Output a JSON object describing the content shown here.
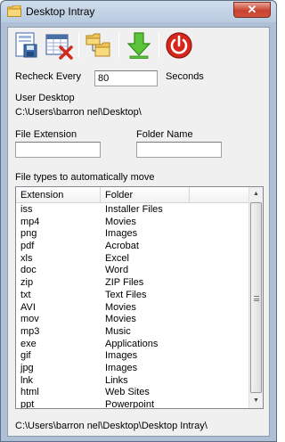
{
  "window": {
    "title": "Desktop Intray",
    "close_glyph": "✕"
  },
  "toolbar": {
    "buttons": [
      {
        "name": "save-icon"
      },
      {
        "name": "remove-type-icon"
      },
      {
        "name": "folders-icon"
      },
      {
        "name": "move-down-icon"
      },
      {
        "name": "power-icon"
      }
    ]
  },
  "recheck": {
    "label": "Recheck Every",
    "value": "80",
    "unit": "Seconds"
  },
  "user_desktop": {
    "label": "User Desktop",
    "path": "C:\\Users\\barron nel\\Desktop\\"
  },
  "file_extension": {
    "label": "File Extension",
    "value": ""
  },
  "folder_name": {
    "label": "Folder Name",
    "value": ""
  },
  "file_types": {
    "label": "File types to automatically move",
    "columns": [
      "Extension",
      "Folder"
    ],
    "rows": [
      [
        "iss",
        "Installer Files"
      ],
      [
        "mp4",
        "Movies"
      ],
      [
        "png",
        "Images"
      ],
      [
        "pdf",
        "Acrobat"
      ],
      [
        "xls",
        "Excel"
      ],
      [
        "doc",
        "Word"
      ],
      [
        "zip",
        "ZIP Files"
      ],
      [
        "txt",
        "Text Files"
      ],
      [
        "AVI",
        "Movies"
      ],
      [
        "mov",
        "Movies"
      ],
      [
        "mp3",
        "Music"
      ],
      [
        "exe",
        "Applications"
      ],
      [
        "gif",
        "Images"
      ],
      [
        "jpg",
        "Images"
      ],
      [
        "lnk",
        "Links"
      ],
      [
        "html",
        "Web Sites"
      ],
      [
        "ppt",
        "Powerpoint"
      ]
    ]
  },
  "status_path": "C:\\Users\\barron nel\\Desktop\\Desktop Intray\\"
}
